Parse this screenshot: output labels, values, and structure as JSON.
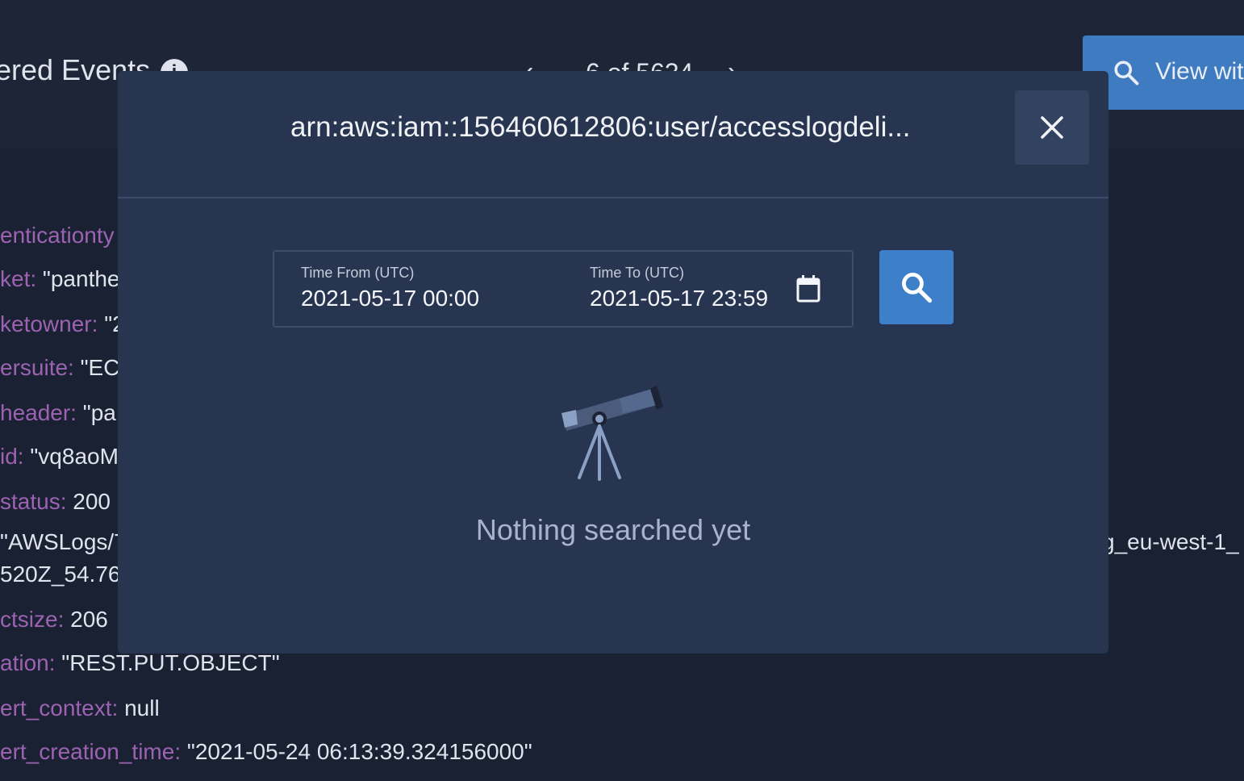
{
  "background": {
    "title": "ered Events",
    "counter": "6 of 5634",
    "view_button_label": "View wit",
    "fields": [
      {
        "key": "enticationty",
        "value": ""
      },
      {
        "key": "ket:",
        "value": "\"panthe"
      },
      {
        "key": "ketowner:",
        "value": "\"2"
      },
      {
        "key": "ersuite:",
        "value": "\"EC"
      },
      {
        "key": "header:",
        "value": "\"pa"
      },
      {
        "key": "id:",
        "value": "\"vq8aoM"
      },
      {
        "key": "status:",
        "value": "200"
      },
      {
        "key": "",
        "value": "\"AWSLogs/7"
      },
      {
        "key": "",
        "value": "520Z_54.76."
      },
      {
        "key": "ctsize:",
        "value": "206"
      },
      {
        "key": "ation:",
        "value": "\"REST.PUT.OBJECT\""
      },
      {
        "key": "ert_context:",
        "value": "null"
      },
      {
        "key": "ert_creation_time:",
        "value": "\"2021-05-24 06:13:39.324156000\""
      }
    ],
    "right_fragment": "g_eu-west-1_"
  },
  "modal": {
    "title": "arn:aws:iam::156460612806:user/accesslogdeli...",
    "time_from_label": "Time From (UTC)",
    "time_from_value": "2021-05-17 00:00",
    "time_to_label": "Time To (UTC)",
    "time_to_value": "2021-05-17 23:59",
    "empty_message": "Nothing searched yet"
  },
  "icons": {
    "close": "close-icon",
    "calendar": "calendar-icon",
    "search": "search-icon",
    "empty_state": "telescope-icon",
    "info": "info-icon"
  },
  "colors": {
    "page_bg": "#1a2132",
    "modal_bg": "#273550",
    "accent": "#3e7fc9",
    "field_key": "#9c63b2"
  }
}
